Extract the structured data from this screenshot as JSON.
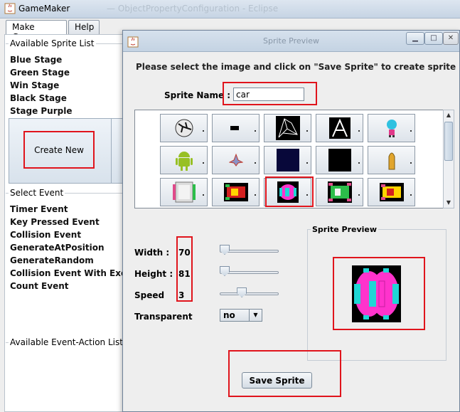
{
  "main_window": {
    "title": "GameMaker",
    "background_title": "— ObjectPropertyConfiguration - Eclipse"
  },
  "tabs": [
    {
      "label": "Make Game",
      "selected": true
    },
    {
      "label": "Help",
      "selected": false
    }
  ],
  "sprite_list": {
    "title": "Available Sprite List",
    "items": [
      "Blue Stage",
      "Green Stage",
      "Win Stage",
      "Black Stage",
      "Stage Purple"
    ]
  },
  "create_new_label": "Create New",
  "event_list": {
    "title": "Select Event",
    "items": [
      "Timer Event",
      "Key Pressed Event",
      "Collision Event",
      "GenerateAtPosition",
      "GenerateRandom",
      "Collision Event With Exception",
      "Count Event"
    ]
  },
  "event_action_list": {
    "title": "Available Event-Action List"
  },
  "dialog": {
    "title": "Sprite Preview",
    "instruction": "Please select the image and click on \"Save Sprite\" to create sprite",
    "sprite_name_label": "Sprite Name :",
    "sprite_name_value": "car",
    "images": [
      "ball",
      "paddle",
      "spider-web",
      "letter-a",
      "character",
      "android",
      "spaceship",
      "blue-square",
      "black-square",
      "bullet",
      "robot-car",
      "red-car",
      "pink-car",
      "green-car",
      "yellow-car"
    ],
    "selected_image_index": 12,
    "properties": [
      {
        "label": "Width :",
        "value": "70",
        "slider_fraction": 0.0
      },
      {
        "label": "Height :",
        "value": "81",
        "slider_fraction": 0.0
      },
      {
        "label": "Speed",
        "value": "3",
        "slider_fraction": 0.35
      }
    ],
    "transparent_label": "Transparent",
    "transparent_value": "no",
    "preview_title": "Sprite Preview",
    "save_label": "Save Sprite"
  },
  "colors": {
    "highlight": "#e0141c",
    "sprite_magenta": "#ff33cc",
    "sprite_cyan": "#1fd6d6"
  }
}
